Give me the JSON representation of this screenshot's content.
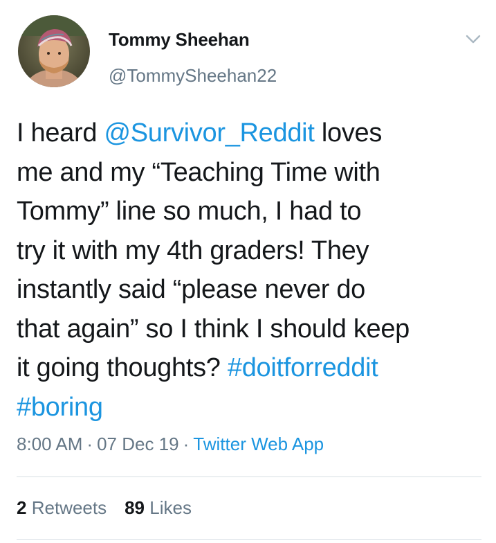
{
  "author": {
    "name": "Tommy Sheehan",
    "handle": "@TommySheehan22"
  },
  "tweet": {
    "lines": [
      [
        {
          "t": "I heard ",
          "type": "text"
        },
        {
          "t": "@Survivor_Reddit",
          "type": "mention"
        },
        {
          "t": " loves",
          "type": "text"
        }
      ],
      [
        {
          "t": "me and my “Teaching Time with",
          "type": "text"
        }
      ],
      [
        {
          "t": "Tommy” line so much, I had to",
          "type": "text"
        }
      ],
      [
        {
          "t": "try it with my 4th graders! They",
          "type": "text"
        }
      ],
      [
        {
          "t": "instantly said “please never do",
          "type": "text"
        }
      ],
      [
        {
          "t": "that again” so I think I should keep",
          "type": "text"
        }
      ],
      [
        {
          "t": "it going thoughts? ",
          "type": "text"
        },
        {
          "t": "#doitforreddit",
          "type": "hashtag"
        }
      ],
      [
        {
          "t": "#boring",
          "type": "hashtag"
        }
      ]
    ]
  },
  "meta": {
    "time": "8:00 AM",
    "separator": "·",
    "date": "07 Dec 19",
    "source": "Twitter Web App"
  },
  "stats": {
    "retweets_count": "2",
    "retweets_label": "Retweets",
    "likes_count": "89",
    "likes_label": "Likes"
  },
  "icons": {
    "menu": "chevron-down-icon"
  },
  "colors": {
    "link": "#1b95e0",
    "secondary_text": "#657786",
    "primary_text": "#14171a",
    "divider": "#d6dde3"
  }
}
